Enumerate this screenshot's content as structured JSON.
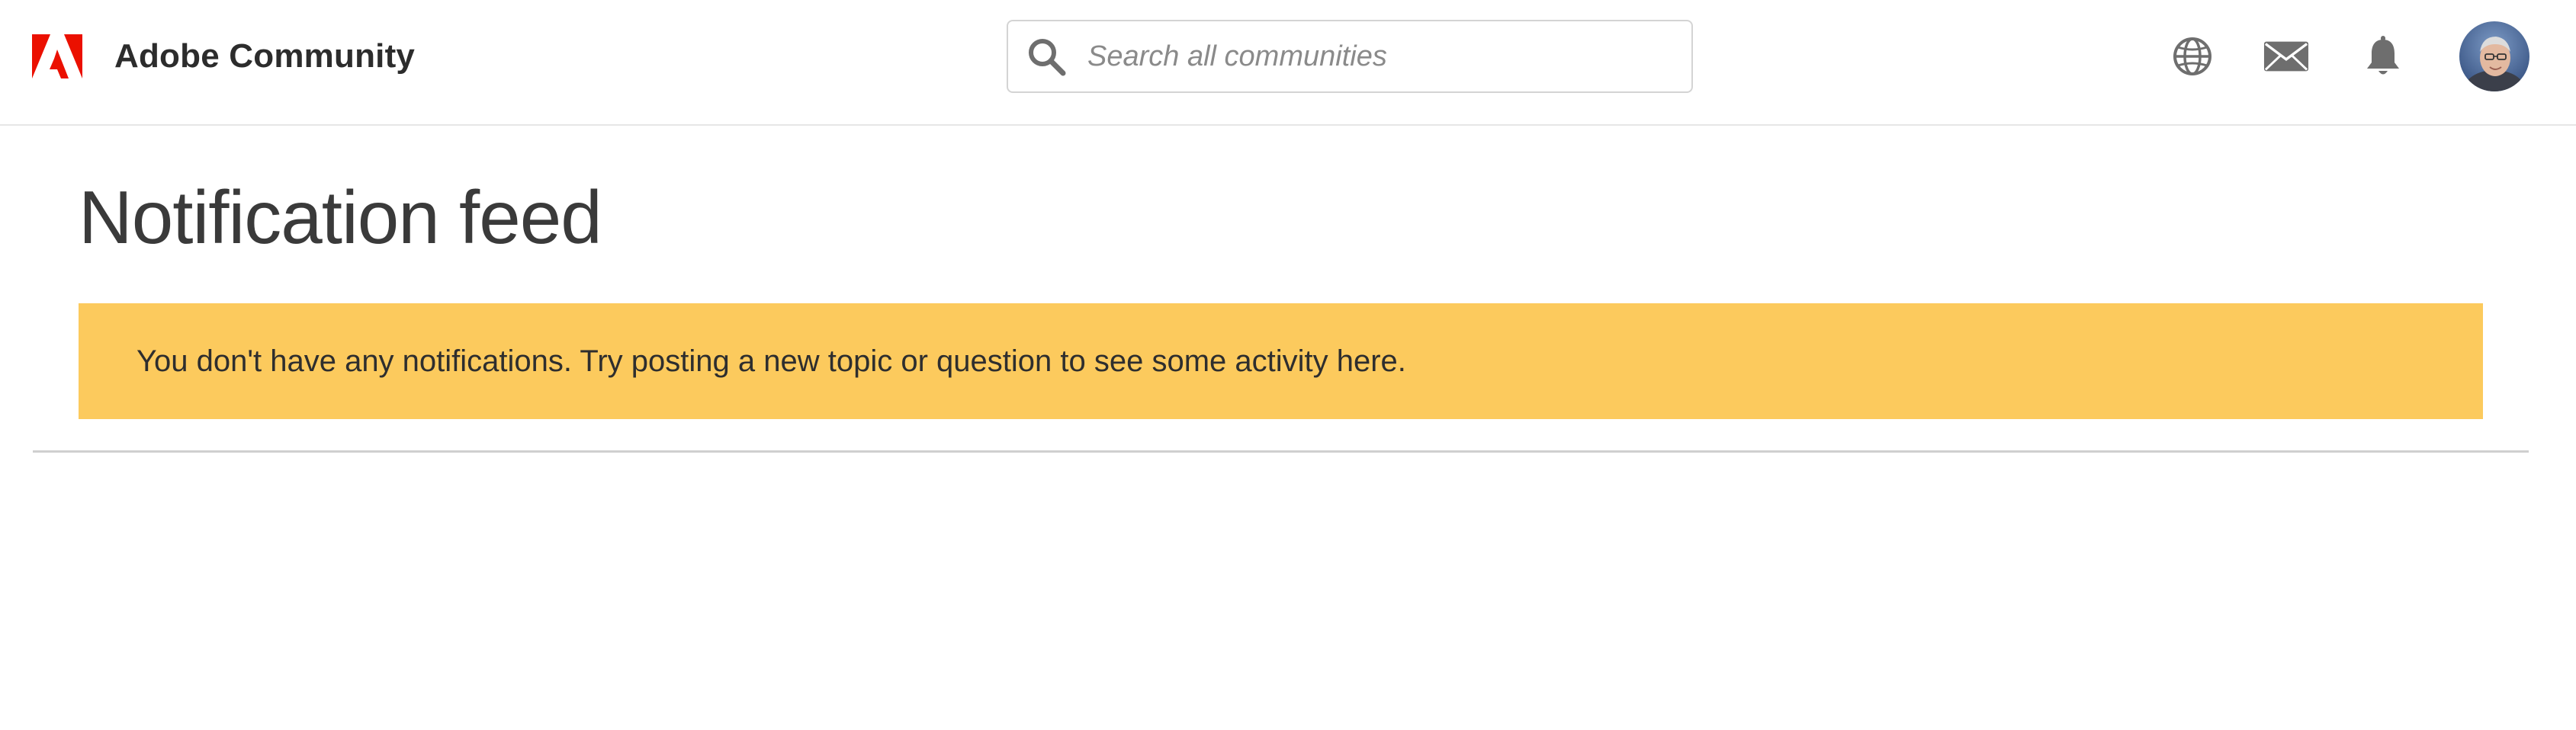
{
  "header": {
    "brand_name": "Adobe Community",
    "search": {
      "placeholder": "Search all communities",
      "value": ""
    },
    "icons": [
      "adobe-logo",
      "search-icon",
      "globe-icon",
      "mail-icon",
      "bell-icon"
    ],
    "colors": {
      "adobe_red": "#eb1000",
      "icon_gray": "#6e6e6e"
    }
  },
  "main": {
    "title": "Notification feed",
    "notice": {
      "text": "You don't have any notifications. Try posting a new topic or question to see some activity here.",
      "background": "#fcca5d"
    }
  }
}
